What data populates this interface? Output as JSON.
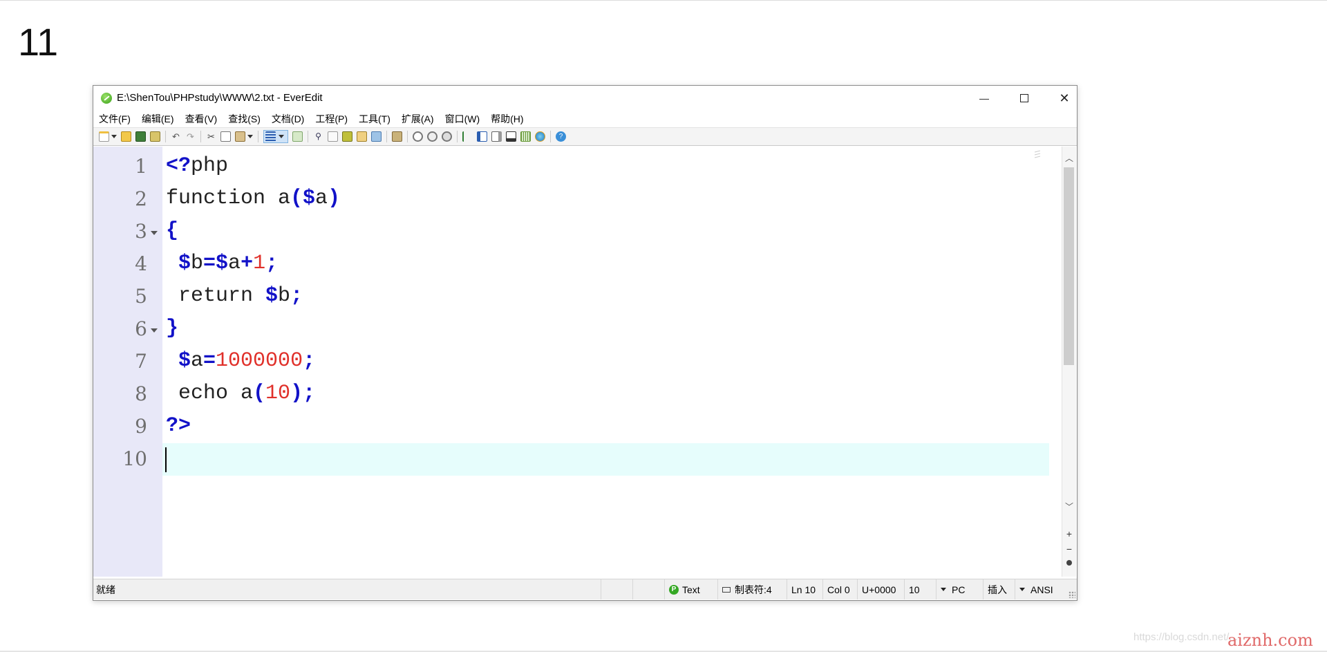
{
  "slide": {
    "number": "11"
  },
  "window": {
    "title": "E:\\ShenTou\\PHPstudy\\WWW\\2.txt - EverEdit",
    "controls": {
      "minimize": "—",
      "maximize": "☐",
      "close": "✕"
    }
  },
  "menu": [
    "文件(F)",
    "编辑(E)",
    "查看(V)",
    "查找(S)",
    "文档(D)",
    "工程(P)",
    "工具(T)",
    "扩展(A)",
    "窗口(W)",
    "帮助(H)"
  ],
  "colors": {
    "keyword": "#1212c8",
    "number": "#e0302a",
    "plain": "#222222",
    "gutter": "#e8e8f8",
    "current_line": "#e6fdfc"
  },
  "code": [
    {
      "num": "1",
      "tokens": [
        {
          "t": "<?",
          "c": "kw"
        },
        {
          "t": "php",
          "c": "plain"
        }
      ]
    },
    {
      "num": "2",
      "tokens": [
        {
          "t": "function a",
          "c": "plain"
        },
        {
          "t": "($",
          "c": "kw"
        },
        {
          "t": "a",
          "c": "plain"
        },
        {
          "t": ")",
          "c": "kw"
        }
      ]
    },
    {
      "num": "3",
      "fold": true,
      "tokens": [
        {
          "t": "{",
          "c": "kw"
        }
      ]
    },
    {
      "num": "4",
      "tokens": [
        {
          "t": " $",
          "c": "kw"
        },
        {
          "t": "b",
          "c": "plain"
        },
        {
          "t": "=$",
          "c": "kw"
        },
        {
          "t": "a",
          "c": "plain"
        },
        {
          "t": "+",
          "c": "kw"
        },
        {
          "t": "1",
          "c": "num"
        },
        {
          "t": ";",
          "c": "kw"
        }
      ]
    },
    {
      "num": "5",
      "tokens": [
        {
          "t": " return ",
          "c": "plain"
        },
        {
          "t": "$",
          "c": "kw"
        },
        {
          "t": "b",
          "c": "plain"
        },
        {
          "t": ";",
          "c": "kw"
        }
      ]
    },
    {
      "num": "6",
      "fold": true,
      "tokens": [
        {
          "t": "}",
          "c": "kw"
        }
      ]
    },
    {
      "num": "7",
      "tokens": [
        {
          "t": " $",
          "c": "kw"
        },
        {
          "t": "a",
          "c": "plain"
        },
        {
          "t": "=",
          "c": "kw"
        },
        {
          "t": "1000000",
          "c": "num"
        },
        {
          "t": ";",
          "c": "kw"
        }
      ]
    },
    {
      "num": "8",
      "tokens": [
        {
          "t": " echo a",
          "c": "plain"
        },
        {
          "t": "(",
          "c": "kw"
        },
        {
          "t": "10",
          "c": "num"
        },
        {
          "t": ");",
          "c": "kw"
        }
      ]
    },
    {
      "num": "9",
      "tokens": [
        {
          "t": "?>",
          "c": "kw"
        }
      ]
    },
    {
      "num": "10",
      "current": true,
      "tokens": []
    }
  ],
  "toolbar_icons": [
    "new-file-icon",
    "open-file-icon",
    "save-icon",
    "save-all-icon",
    "undo-icon",
    "redo-icon",
    "cut-icon",
    "copy-icon",
    "paste-icon",
    "word-wrap-icon",
    "column-mode-icon",
    "find-icon",
    "find-in-files-icon",
    "replace-icon",
    "find-next-icon",
    "bookmark-icon",
    "macro-record-icon",
    "macro-play-icon",
    "macro-stop-icon",
    "outline-icon",
    "sidebar-icon",
    "output-panel-icon",
    "ruler-icon",
    "hex-view-icon",
    "browser-preview-icon",
    "help-icon"
  ],
  "status": {
    "ready": "就绪",
    "syntax": "Text",
    "tab": "制表符:4",
    "line": "Ln 10",
    "col": "Col 0",
    "unicode": "U+0000",
    "offset": "10",
    "line_ending": "PC",
    "insert_mode": "插入",
    "encoding": "ANSI"
  },
  "watermark": {
    "url": "https://blog.csdn.net/...",
    "brand": "aiznh.com"
  }
}
